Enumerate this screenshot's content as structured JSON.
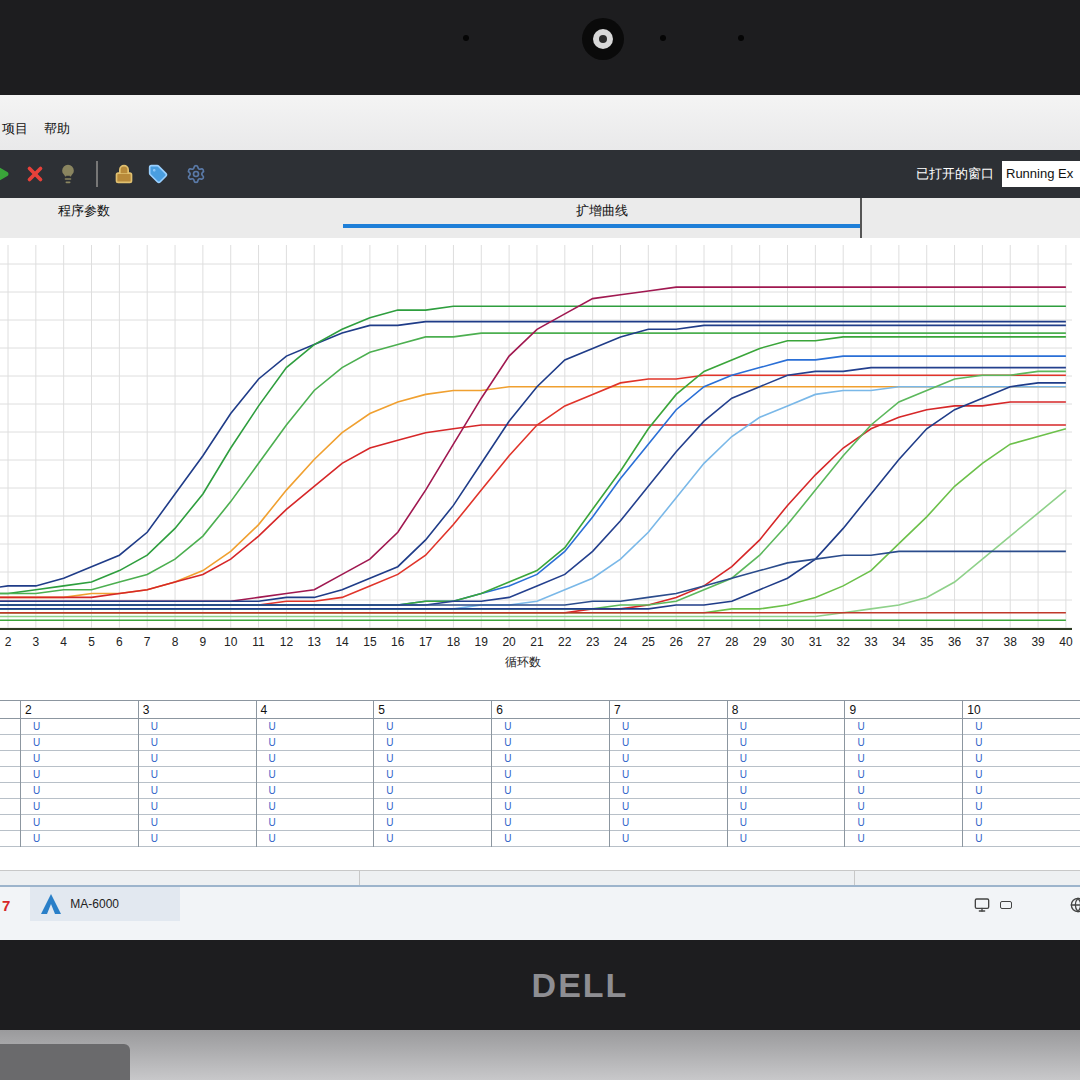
{
  "bezel": {
    "logo": "DELL"
  },
  "menu": [
    "项目",
    "帮助"
  ],
  "toolbar": {
    "open_windows_label": "已打开的窗口",
    "open_windows_value": "Running Ex"
  },
  "tabs": [
    {
      "label": "程序参数",
      "selected": false
    },
    {
      "label": "扩增曲线",
      "selected": true
    }
  ],
  "chart": {
    "x_axis": {
      "title": "循环数",
      "ticks": [
        "2",
        "3",
        "4",
        "5",
        "6",
        "7",
        "8",
        "9",
        "10",
        "11",
        "12",
        "13",
        "14",
        "15",
        "16",
        "17",
        "18",
        "19",
        "20",
        "21",
        "22",
        "23",
        "24",
        "25",
        "26",
        "27",
        "28",
        "29",
        "30",
        "31",
        "32",
        "33",
        "34",
        "35",
        "36",
        "37",
        "38",
        "39",
        "40"
      ]
    },
    "series": [
      {
        "color": "#1f3c88",
        "values": [
          10,
          11,
          11,
          13,
          16,
          19,
          25,
          35,
          45,
          56,
          65,
          71,
          74,
          77,
          79,
          79,
          80,
          80,
          80,
          80,
          80,
          80,
          80,
          80,
          80,
          80,
          80,
          80,
          80,
          80,
          80,
          80,
          80,
          80,
          80,
          80,
          80,
          80,
          80,
          80
        ]
      },
      {
        "color": "#2e9e3e",
        "values": [
          9,
          9,
          10,
          11,
          12,
          15,
          19,
          26,
          35,
          47,
          58,
          68,
          74,
          78,
          81,
          83,
          83,
          84,
          84,
          84,
          84,
          84,
          84,
          84,
          84,
          84,
          84,
          84,
          84,
          84,
          84,
          84,
          84,
          84,
          84,
          84,
          84,
          84,
          84,
          84
        ]
      },
      {
        "color": "#4caf50",
        "values": [
          9,
          9,
          9,
          10,
          10,
          12,
          14,
          18,
          24,
          33,
          43,
          53,
          62,
          68,
          72,
          74,
          76,
          76,
          77,
          77,
          77,
          77,
          77,
          77,
          77,
          77,
          77,
          77,
          77,
          77,
          77,
          77,
          77,
          77,
          77,
          77,
          77,
          77,
          77,
          77
        ]
      },
      {
        "color": "#f0a030",
        "values": [
          8,
          8,
          8,
          8,
          9,
          9,
          10,
          12,
          15,
          20,
          27,
          36,
          44,
          51,
          56,
          59,
          61,
          62,
          62,
          63,
          63,
          63,
          63,
          63,
          63,
          63,
          63,
          63,
          63,
          63,
          63,
          63,
          63,
          63,
          63,
          63,
          63,
          63,
          63,
          63
        ]
      },
      {
        "color": "#d62728",
        "values": [
          8,
          8,
          8,
          8,
          8,
          9,
          10,
          12,
          14,
          18,
          24,
          31,
          37,
          43,
          47,
          49,
          51,
          52,
          53,
          53,
          53,
          53,
          53,
          53,
          53,
          53,
          53,
          53,
          53,
          53,
          53,
          53,
          53,
          53,
          53,
          53,
          53,
          53,
          53,
          53
        ]
      },
      {
        "color": "#a01850",
        "values": [
          7,
          7,
          7,
          7,
          7,
          7,
          7,
          7,
          7,
          7,
          8,
          9,
          10,
          14,
          18,
          25,
          36,
          48,
          60,
          71,
          78,
          82,
          86,
          87,
          88,
          89,
          89,
          89,
          89,
          89,
          89,
          89,
          89,
          89,
          89,
          89,
          89,
          89,
          89,
          89
        ]
      },
      {
        "color": "#1f3c88",
        "values": [
          7,
          7,
          7,
          7,
          7,
          7,
          7,
          7,
          7,
          7,
          7,
          8,
          8,
          10,
          13,
          16,
          23,
          32,
          43,
          54,
          63,
          70,
          73,
          76,
          78,
          78,
          79,
          79,
          79,
          79,
          79,
          79,
          79,
          79,
          79,
          79,
          79,
          79,
          79,
          79
        ]
      },
      {
        "color": "#e0342a",
        "values": [
          6,
          6,
          6,
          6,
          6,
          6,
          6,
          6,
          6,
          6,
          6,
          7,
          7,
          8,
          11,
          14,
          19,
          27,
          36,
          45,
          53,
          58,
          61,
          64,
          65,
          65,
          66,
          66,
          66,
          66,
          66,
          66,
          66,
          66,
          66,
          66,
          66,
          66,
          66,
          66
        ]
      },
      {
        "color": "#2a6fd6",
        "values": [
          6,
          6,
          6,
          6,
          6,
          6,
          6,
          6,
          6,
          6,
          6,
          6,
          6,
          6,
          6,
          6,
          7,
          7,
          9,
          11,
          14,
          20,
          29,
          39,
          48,
          57,
          63,
          66,
          68,
          70,
          70,
          71,
          71,
          71,
          71,
          71,
          71,
          71,
          71,
          71
        ]
      },
      {
        "color": "#3aa53a",
        "values": [
          6,
          6,
          6,
          6,
          6,
          6,
          6,
          6,
          6,
          6,
          6,
          6,
          6,
          6,
          6,
          6,
          7,
          7,
          9,
          12,
          15,
          21,
          31,
          41,
          52,
          61,
          67,
          70,
          73,
          75,
          75,
          76,
          76,
          76,
          76,
          76,
          76,
          76,
          76,
          76
        ]
      },
      {
        "color": "#24408e",
        "values": [
          6,
          6,
          6,
          6,
          6,
          6,
          6,
          6,
          6,
          6,
          6,
          6,
          6,
          6,
          6,
          6,
          6,
          7,
          7,
          8,
          11,
          14,
          20,
          28,
          37,
          46,
          54,
          60,
          63,
          66,
          67,
          67,
          68,
          68,
          68,
          68,
          68,
          68,
          68,
          68
        ]
      },
      {
        "color": "#7ab8e8",
        "values": [
          5,
          5,
          5,
          5,
          5,
          5,
          5,
          5,
          5,
          5,
          5,
          5,
          5,
          5,
          5,
          5,
          5,
          5,
          6,
          6,
          7,
          10,
          13,
          18,
          25,
          34,
          43,
          50,
          55,
          58,
          61,
          62,
          62,
          63,
          63,
          63,
          63,
          63,
          63,
          63
        ]
      },
      {
        "color": "#d62728",
        "values": [
          4,
          4,
          4,
          4,
          4,
          4,
          4,
          4,
          4,
          4,
          4,
          4,
          4,
          4,
          4,
          4,
          4,
          4,
          4,
          4,
          4,
          4,
          5,
          5,
          6,
          8,
          11,
          16,
          23,
          32,
          40,
          47,
          52,
          55,
          57,
          58,
          58,
          59,
          59,
          59
        ]
      },
      {
        "color": "#5cb85c",
        "values": [
          5,
          5,
          5,
          5,
          5,
          5,
          5,
          5,
          5,
          5,
          5,
          5,
          5,
          5,
          5,
          5,
          5,
          5,
          5,
          5,
          5,
          5,
          5,
          6,
          6,
          7,
          10,
          13,
          19,
          27,
          36,
          45,
          53,
          59,
          62,
          65,
          66,
          66,
          67,
          67
        ]
      },
      {
        "color": "#1f3c88",
        "values": [
          5,
          5,
          5,
          5,
          5,
          5,
          5,
          5,
          5,
          5,
          5,
          5,
          5,
          5,
          5,
          5,
          5,
          5,
          5,
          5,
          5,
          5,
          5,
          5,
          5,
          6,
          6,
          7,
          10,
          13,
          18,
          26,
          35,
          44,
          52,
          57,
          60,
          63,
          64,
          64
        ]
      },
      {
        "color": "#6cc04a",
        "values": [
          4,
          4,
          4,
          4,
          4,
          4,
          4,
          4,
          4,
          4,
          4,
          4,
          4,
          4,
          4,
          4,
          4,
          4,
          4,
          4,
          4,
          4,
          4,
          4,
          4,
          4,
          4,
          5,
          5,
          6,
          8,
          11,
          15,
          22,
          29,
          37,
          43,
          48,
          50,
          52
        ]
      },
      {
        "color": "#8fd18a",
        "values": [
          3,
          3,
          3,
          3,
          3,
          3,
          3,
          3,
          3,
          3,
          3,
          3,
          3,
          3,
          3,
          3,
          3,
          3,
          3,
          3,
          3,
          3,
          3,
          3,
          3,
          3,
          3,
          3,
          3,
          3,
          3,
          4,
          5,
          6,
          8,
          12,
          18,
          24,
          30,
          36
        ]
      },
      {
        "color": "#2b4c8c",
        "values": [
          6,
          6,
          6,
          6,
          6,
          6,
          6,
          6,
          6,
          6,
          6,
          6,
          6,
          6,
          6,
          6,
          6,
          6,
          6,
          6,
          6,
          6,
          7,
          7,
          8,
          9,
          11,
          13,
          15,
          17,
          18,
          19,
          19,
          20,
          20,
          20,
          20,
          20,
          20,
          20
        ]
      },
      {
        "color": "#3aa53a",
        "values": [
          2,
          2,
          2,
          2,
          2,
          2,
          2,
          2,
          2,
          2,
          2,
          2,
          2,
          2,
          2,
          2,
          2,
          2,
          2,
          2,
          2,
          2,
          2,
          2,
          2,
          2,
          2,
          2,
          2,
          2,
          2,
          2,
          2,
          2,
          2,
          2,
          2,
          2,
          2,
          2
        ]
      },
      {
        "color": "#c0392b",
        "values": [
          4,
          4,
          4,
          4,
          4,
          4,
          4,
          4,
          4,
          4,
          4,
          4,
          4,
          4,
          4,
          4,
          4,
          4,
          4,
          4,
          4,
          4,
          4,
          4,
          4,
          4,
          4,
          4,
          4,
          4,
          4,
          4,
          4,
          4,
          4,
          4,
          4,
          4,
          4,
          4
        ]
      }
    ]
  },
  "table": {
    "columns": [
      {
        "label": "2",
        "cells": [
          "U",
          "U",
          "U",
          "U",
          "U",
          "U",
          "U",
          "U"
        ]
      },
      {
        "label": "3",
        "cells": [
          "U",
          "U",
          "U",
          "U",
          "U",
          "U",
          "U",
          "U"
        ]
      },
      {
        "label": "4",
        "cells": [
          "U",
          "U",
          "U",
          "U",
          "U",
          "U",
          "U",
          "U"
        ]
      },
      {
        "label": "5",
        "cells": [
          "U",
          "U",
          "U",
          "U",
          "U",
          "U",
          "U",
          "U"
        ]
      },
      {
        "label": "6",
        "cells": [
          "U",
          "U",
          "U",
          "U",
          "U",
          "U",
          "U",
          "U"
        ]
      },
      {
        "label": "7",
        "cells": [
          "U",
          "U",
          "U",
          "U",
          "U",
          "U",
          "U",
          "U"
        ]
      },
      {
        "label": "8",
        "cells": [
          "U",
          "U",
          "U",
          "U",
          "U",
          "U",
          "U",
          "U"
        ]
      },
      {
        "label": "9",
        "cells": [
          "U",
          "U",
          "U",
          "U",
          "U",
          "U",
          "U",
          "U"
        ]
      },
      {
        "label": "10",
        "cells": [
          "U",
          "U",
          "U",
          "U",
          "U",
          "U",
          "U",
          "U"
        ]
      }
    ]
  },
  "taskbar": {
    "fragment": "7",
    "items": [
      {
        "label": "MA-6000",
        "selected": true
      }
    ]
  }
}
